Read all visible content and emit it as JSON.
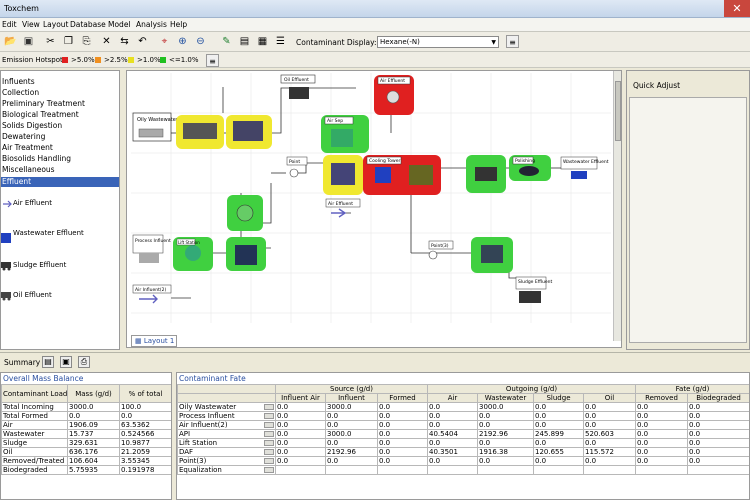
{
  "window": {
    "title": "Toxchem"
  },
  "menu": [
    "Edit",
    "View",
    "Layout",
    "Database",
    "Model",
    "Analysis",
    "Help"
  ],
  "toolbar": {
    "icons": [
      "folder-open-icon",
      "save-icon",
      "cut-icon",
      "copy-icon",
      "paste-icon",
      "delete-icon",
      "flip-horizontal-icon",
      "undo-icon",
      "zoom-region-icon",
      "zoom-in-icon",
      "zoom-out-icon",
      "edit-icon",
      "chart-icon",
      "run-icon",
      "list-icon"
    ],
    "contaminant_display_label": "Contaminant Display:",
    "contaminant_display_value": "Hexane(-N)"
  },
  "hotspots": {
    "label": "Emission Hotspots",
    "legend": [
      {
        "label": ">5.0%",
        "color": "#e02020"
      },
      {
        "label": ">2.5%",
        "color": "#f09020"
      },
      {
        "label": ">1.0%",
        "color": "#e8e020"
      },
      {
        "label": "<=1.0%",
        "color": "#20c020"
      }
    ]
  },
  "categories": {
    "items": [
      "Influents",
      "Collection",
      "Preliminary Treatment",
      "Biological Treatment",
      "Solids Digestion",
      "Dewatering",
      "Air Treatment",
      "Biosolids Handling",
      "Miscellaneous",
      "Effluent"
    ],
    "selected": "Effluent"
  },
  "effluents": [
    {
      "label": "Air Effluent",
      "icon": "air-effluent-icon"
    },
    {
      "label": "Wastewater Effluent",
      "icon": "wastewater-effluent-icon"
    },
    {
      "label": "Sludge Effluent",
      "icon": "sludge-effluent-icon"
    },
    {
      "label": "Oil Effluent",
      "icon": "oil-effluent-icon"
    }
  ],
  "flowsheet": {
    "nodes": [
      {
        "label": "Oily Wastewater"
      },
      {
        "label": "Oil Effluent"
      },
      {
        "label": "Air Effluent"
      },
      {
        "label": "Air Sep"
      },
      {
        "label": "Point"
      },
      {
        "label": "Air Effluent"
      },
      {
        "label": "Cooling Tower"
      },
      {
        "label": "Polishing"
      },
      {
        "label": "Wastewater Effluent"
      },
      {
        "label": "Process Influent"
      },
      {
        "label": "Lift Station"
      },
      {
        "label": "Air Influent(2)"
      },
      {
        "label": "Point(3)"
      },
      {
        "label": "Sludge Effluent"
      }
    ]
  },
  "layout_tab": "Layout 1",
  "quick_adjust": {
    "title": "Quick Adjust"
  },
  "summary": {
    "label": "Summary"
  },
  "mass_balance": {
    "title": "Overall Mass Balance",
    "columns": [
      "Contaminant Load",
      "Mass (g/d)",
      "% of total"
    ],
    "rows": [
      [
        "Total Incoming",
        "3000.0",
        "100.0"
      ],
      [
        "Total Formed",
        "0.0",
        "0.0"
      ],
      [
        "Air",
        "1906.09",
        "63.5362"
      ],
      [
        "Wastewater",
        "15.737",
        "0.524566"
      ],
      [
        "Sludge",
        "329.631",
        "10.9877"
      ],
      [
        "Oil",
        "636.176",
        "21.2059"
      ],
      [
        "Removed/Treated",
        "106.604",
        "3.55345"
      ],
      [
        "Biodegraded",
        "5.75935",
        "0.191978"
      ]
    ]
  },
  "fate": {
    "title": "Contaminant Fate",
    "groups": [
      {
        "label": "Source (g/d)",
        "cols": [
          "Influent Air",
          "Influent",
          "Formed"
        ]
      },
      {
        "label": "Outgoing (g/d)",
        "cols": [
          "Air",
          "Wastewater",
          "Sludge",
          "Oil"
        ]
      },
      {
        "label": "Fate (g/d)",
        "cols": [
          "Removed",
          "Biodegraded"
        ]
      }
    ],
    "rows": [
      [
        "Oily Wastewater",
        "0.0",
        "3000.0",
        "0.0",
        "0.0",
        "3000.0",
        "0.0",
        "0.0",
        "0.0",
        "0.0"
      ],
      [
        "Process Influent",
        "0.0",
        "0.0",
        "0.0",
        "0.0",
        "0.0",
        "0.0",
        "0.0",
        "0.0",
        "0.0"
      ],
      [
        "Air Influent(2)",
        "0.0",
        "0.0",
        "0.0",
        "0.0",
        "0.0",
        "0.0",
        "0.0",
        "0.0",
        "0.0"
      ],
      [
        "API",
        "0.0",
        "3000.0",
        "0.0",
        "40.5404",
        "2192.96",
        "245.899",
        "520.603",
        "0.0",
        "0.0"
      ],
      [
        "Lift Station",
        "0.0",
        "0.0",
        "0.0",
        "0.0",
        "0.0",
        "0.0",
        "0.0",
        "0.0",
        "0.0"
      ],
      [
        "DAF",
        "0.0",
        "2192.96",
        "0.0",
        "40.3501",
        "1916.38",
        "120.655",
        "115.572",
        "0.0",
        "0.0"
      ],
      [
        "Point(3)",
        "0.0",
        "0.0",
        "0.0",
        "0.0",
        "0.0",
        "0.0",
        "0.0",
        "0.0",
        "0.0"
      ],
      [
        "Equalization",
        "",
        "",
        "",
        "",
        "",
        "",
        "",
        "",
        ""
      ]
    ]
  }
}
